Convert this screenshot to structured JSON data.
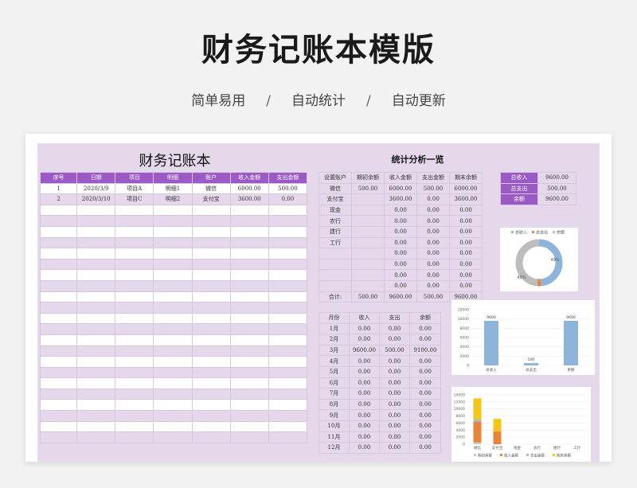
{
  "page": {
    "title": "财务记账本模版",
    "subtitle": [
      "简单易用",
      "自动统计",
      "自动更新"
    ],
    "separator": "/"
  },
  "ledger": {
    "title": "财务记账本",
    "headers": [
      "序号",
      "日期",
      "项目",
      "明细",
      "账户",
      "收入金额",
      "支出金额"
    ],
    "rows": [
      [
        "1",
        "2020/3/9",
        "项目A",
        "明细1",
        "微信",
        "6000.00",
        "500.00"
      ],
      [
        "2",
        "2020/3/10",
        "项目C",
        "明细2",
        "支付宝",
        "3600.00",
        "0.00"
      ]
    ]
  },
  "stats": {
    "title": "统计分析一览",
    "account_headers": [
      "设置账户",
      "期初余额",
      "收入金额",
      "支出金额",
      "期末余额"
    ],
    "account_rows": [
      [
        "微信",
        "500.00",
        "6000.00",
        "500.00",
        "6000.00"
      ],
      [
        "支付宝",
        "",
        "3600.00",
        "0.00",
        "3600.00"
      ],
      [
        "现金",
        "",
        "0.00",
        "0.00",
        "0.00"
      ],
      [
        "农行",
        "",
        "0.00",
        "0.00",
        "0.00"
      ],
      [
        "建行",
        "",
        "0.00",
        "0.00",
        "0.00"
      ],
      [
        "工行",
        "",
        "0.00",
        "0.00",
        "0.00"
      ],
      [
        "",
        "",
        "0.00",
        "0.00",
        "0.00"
      ],
      [
        "",
        "",
        "0.00",
        "0.00",
        "0.00"
      ],
      [
        "",
        "",
        "0.00",
        "0.00",
        "0.00"
      ],
      [
        "",
        "",
        "0.00",
        "0.00",
        "0.00"
      ]
    ],
    "account_total": [
      "合计:",
      "500.00",
      "9600.00",
      "500.00",
      "9600.00"
    ],
    "month_headers": [
      "月份",
      "收入",
      "支出",
      "余额"
    ],
    "month_rows": [
      [
        "1月",
        "0.00",
        "0.00",
        "0.00"
      ],
      [
        "2月",
        "0.00",
        "0.00",
        "0.00"
      ],
      [
        "3月",
        "9600.00",
        "500.00",
        "9100.00"
      ],
      [
        "4月",
        "0.00",
        "0.00",
        "0.00"
      ],
      [
        "5月",
        "0.00",
        "0.00",
        "0.00"
      ],
      [
        "6月",
        "0.00",
        "0.00",
        "0.00"
      ],
      [
        "7月",
        "0.00",
        "0.00",
        "0.00"
      ],
      [
        "8月",
        "0.00",
        "0.00",
        "0.00"
      ],
      [
        "9月",
        "0.00",
        "0.00",
        "0.00"
      ],
      [
        "10月",
        "0.00",
        "0.00",
        "0.00"
      ],
      [
        "11月",
        "0.00",
        "0.00",
        "0.00"
      ],
      [
        "12月",
        "0.00",
        "0.00",
        "0.00"
      ]
    ],
    "totals": [
      [
        "总收入",
        "9600.00"
      ],
      [
        "总支出",
        "500.00"
      ],
      [
        "余额",
        "9600.00"
      ]
    ]
  },
  "colors": {
    "accent": "#9b59c5",
    "sheet_bg": "#e4d8ea",
    "bar_blue": "#8fb4d9",
    "bar_orange": "#e8833a",
    "bar_yellow": "#f5c518",
    "donut_gray": "#bdbdbd"
  },
  "chart_data": [
    {
      "type": "pie",
      "variant": "donut",
      "labels": [
        "总收入",
        "总支出",
        "余额"
      ],
      "values": [
        9600,
        500,
        9600
      ],
      "data_labels": [
        "49%",
        "49%"
      ],
      "legend_position": "top"
    },
    {
      "type": "bar",
      "categories": [
        "总收入",
        "总支出",
        "余额"
      ],
      "values": [
        9600,
        500,
        9600
      ],
      "ylim": [
        0,
        12000
      ],
      "yticks": [
        "0",
        "2000",
        "4000",
        "6000",
        "8000",
        "10000",
        "12000"
      ],
      "data_labels": [
        "9600",
        "500",
        "9600"
      ]
    },
    {
      "type": "bar",
      "stacked": true,
      "categories": [
        "微信",
        "支付宝",
        "现金",
        "农行",
        "建行",
        "工行"
      ],
      "series": [
        {
          "name": "期初余额",
          "values": [
            500,
            0,
            0,
            0,
            0,
            0
          ]
        },
        {
          "name": "收入金额",
          "values": [
            6000,
            3600,
            0,
            0,
            0,
            0
          ]
        },
        {
          "name": "支出金额",
          "values": [
            500,
            0,
            0,
            0,
            0,
            0
          ]
        },
        {
          "name": "期末余额",
          "values": [
            6000,
            3600,
            0,
            0,
            0,
            0
          ]
        }
      ],
      "ylim": [
        0,
        14000
      ],
      "yticks": [
        "0",
        "2000",
        "4000",
        "6000",
        "8000",
        "10000",
        "12000",
        "14000"
      ],
      "legend_position": "bottom"
    }
  ]
}
